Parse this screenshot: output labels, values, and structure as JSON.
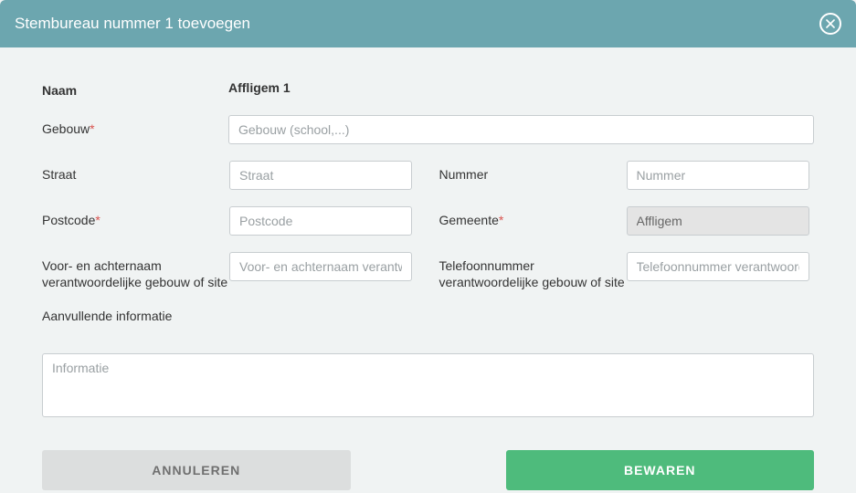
{
  "modal": {
    "title": "Stembureau nummer 1 toevoegen"
  },
  "form": {
    "naam": {
      "label": "Naam",
      "value": "Affligem 1"
    },
    "gebouw": {
      "label": "Gebouw",
      "placeholder": "Gebouw (school,...)",
      "required": true
    },
    "straat": {
      "label": "Straat",
      "placeholder": "Straat"
    },
    "nummer": {
      "label": "Nummer",
      "placeholder": "Nummer"
    },
    "postcode": {
      "label": "Postcode",
      "placeholder": "Postcode",
      "required": true
    },
    "gemeente": {
      "label": "Gemeente",
      "value": "Affligem",
      "required": true
    },
    "verantwoordelijke_naam": {
      "label": "Voor- en achternaam verantwoordelijke gebouw of site",
      "placeholder": "Voor- en achternaam verantwoordelijke gebouw of site"
    },
    "verantwoordelijke_tel": {
      "label": "Telefoonnummer verantwoordelijke gebouw of site",
      "placeholder": "Telefoonnummer verantwoordelijke gebouw of site"
    },
    "aanvullende_info": {
      "label": "Aanvullende informatie",
      "placeholder": "Informatie"
    }
  },
  "buttons": {
    "cancel": "ANNULEREN",
    "save": "BEWAREN"
  }
}
